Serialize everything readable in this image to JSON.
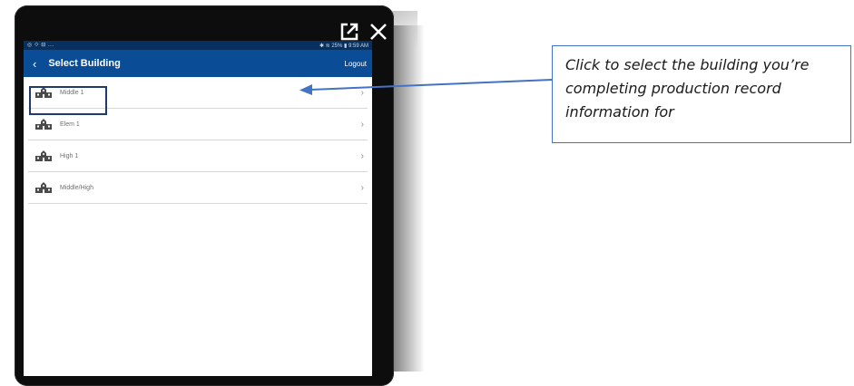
{
  "status_bar": {
    "left": "◎ ⟐ ⊟ ...",
    "right": "✱ ≋ 25% ▮ 9:59 AM"
  },
  "app_bar": {
    "title": "Select Building",
    "logout_label": "Logout"
  },
  "buildings": [
    {
      "label": "Middle 1"
    },
    {
      "label": "Elem 1"
    },
    {
      "label": "High 1"
    },
    {
      "label": "Middle/High"
    }
  ],
  "callout": {
    "text": "Click to select the building you’re completing production record information for"
  },
  "colors": {
    "app_bar": "#0a4d96",
    "status_bar": "#08305f",
    "highlight_box": "#1f3b6e",
    "arrow": "#4472c4",
    "callout_border": "#4472c4"
  },
  "icons": {
    "open_external": "open-external-icon",
    "close": "close-icon",
    "back": "chevron-left-icon",
    "building": "school-building-icon",
    "row_chevron": "chevron-right-icon"
  }
}
